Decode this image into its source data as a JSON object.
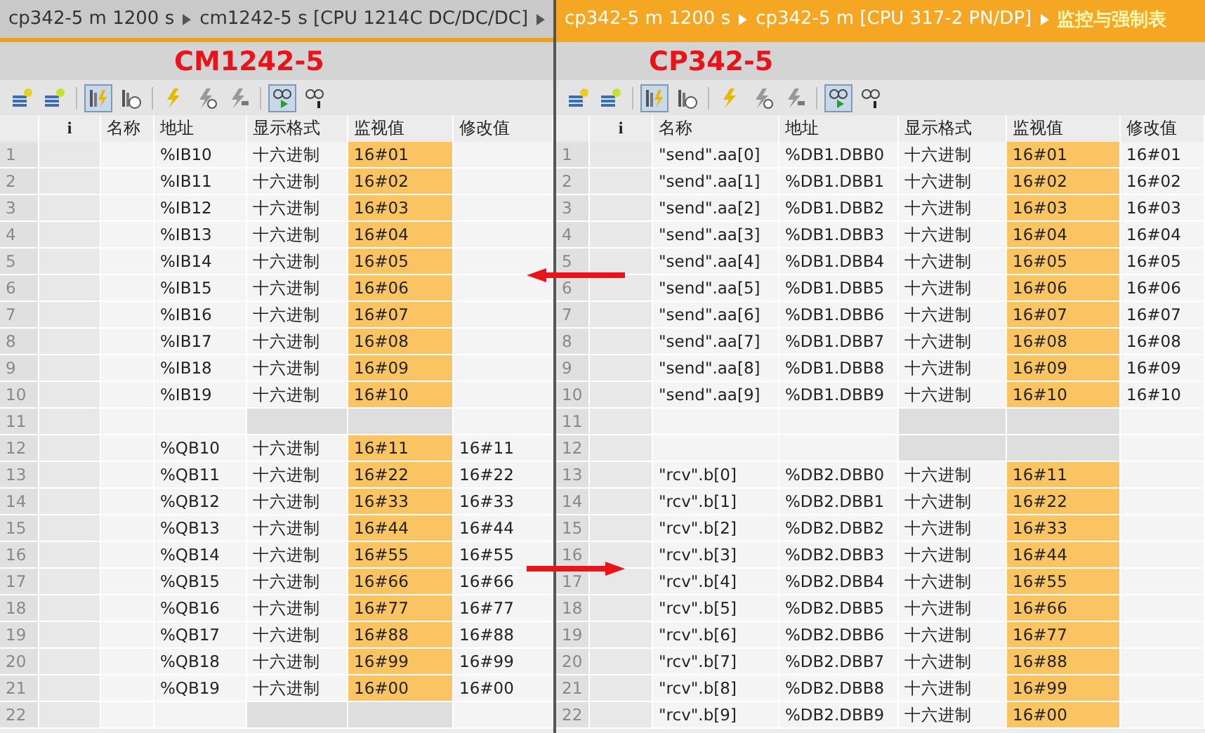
{
  "panels": [
    {
      "active": false,
      "breadcrumb": [
        "cp342-5 m 1200 s",
        "cm1242-5 s [CPU 1214C DC/DC/DC]"
      ],
      "trailing_separator": true,
      "label": "CM1242-5",
      "toolbar": [
        {
          "kind": "insert",
          "selected": false
        },
        {
          "kind": "add",
          "selected": false
        },
        {
          "kind": "monitor-flash",
          "selected": true
        },
        {
          "kind": "monitor-clock",
          "selected": false
        },
        {
          "kind": "flash",
          "selected": false
        },
        {
          "kind": "flash-clock",
          "selected": false
        },
        {
          "kind": "flash-pen",
          "selected": false
        },
        {
          "kind": "glasses-play",
          "selected": true
        },
        {
          "kind": "glasses",
          "selected": false
        }
      ],
      "columns": [
        "i",
        "名称",
        "地址",
        "显示格式",
        "监视值",
        "修改值"
      ],
      "rows": [
        {
          "no": "1",
          "address": "%IB10",
          "format": "十六进制",
          "monitor": "16#01"
        },
        {
          "no": "2",
          "address": "%IB11",
          "format": "十六进制",
          "monitor": "16#02"
        },
        {
          "no": "3",
          "address": "%IB12",
          "format": "十六进制",
          "monitor": "16#03"
        },
        {
          "no": "4",
          "address": "%IB13",
          "format": "十六进制",
          "monitor": "16#04"
        },
        {
          "no": "5",
          "address": "%IB14",
          "format": "十六进制",
          "monitor": "16#05"
        },
        {
          "no": "6",
          "address": "%IB15",
          "format": "十六进制",
          "monitor": "16#06"
        },
        {
          "no": "7",
          "address": "%IB16",
          "format": "十六进制",
          "monitor": "16#07"
        },
        {
          "no": "8",
          "address": "%IB17",
          "format": "十六进制",
          "monitor": "16#08"
        },
        {
          "no": "9",
          "address": "%IB18",
          "format": "十六进制",
          "monitor": "16#09"
        },
        {
          "no": "10",
          "address": "%IB19",
          "format": "十六进制",
          "monitor": "16#10"
        },
        {
          "no": "11"
        },
        {
          "no": "12",
          "address": "%QB10",
          "format": "十六进制",
          "monitor": "16#11",
          "modify": "16#11"
        },
        {
          "no": "13",
          "address": "%QB11",
          "format": "十六进制",
          "monitor": "16#22",
          "modify": "16#22"
        },
        {
          "no": "14",
          "address": "%QB12",
          "format": "十六进制",
          "monitor": "16#33",
          "modify": "16#33"
        },
        {
          "no": "15",
          "address": "%QB13",
          "format": "十六进制",
          "monitor": "16#44",
          "modify": "16#44"
        },
        {
          "no": "16",
          "address": "%QB14",
          "format": "十六进制",
          "monitor": "16#55",
          "modify": "16#55"
        },
        {
          "no": "17",
          "address": "%QB15",
          "format": "十六进制",
          "monitor": "16#66",
          "modify": "16#66"
        },
        {
          "no": "18",
          "address": "%QB16",
          "format": "十六进制",
          "monitor": "16#77",
          "modify": "16#77"
        },
        {
          "no": "19",
          "address": "%QB17",
          "format": "十六进制",
          "monitor": "16#88",
          "modify": "16#88"
        },
        {
          "no": "20",
          "address": "%QB18",
          "format": "十六进制",
          "monitor": "16#99",
          "modify": "16#99"
        },
        {
          "no": "21",
          "address": "%QB19",
          "format": "十六进制",
          "monitor": "16#00",
          "modify": "16#00"
        },
        {
          "no": "22"
        }
      ]
    },
    {
      "active": true,
      "breadcrumb": [
        "cp342-5 m 1200 s",
        "cp342-5 m [CPU 317-2 PN/DP]",
        "监控与强制表"
      ],
      "trailing_separator": false,
      "label": "CP342-5",
      "toolbar": [
        {
          "kind": "insert",
          "selected": false
        },
        {
          "kind": "add",
          "selected": false
        },
        {
          "kind": "monitor-flash",
          "selected": true
        },
        {
          "kind": "monitor-clock",
          "selected": false
        },
        {
          "kind": "flash",
          "selected": false
        },
        {
          "kind": "flash-clock",
          "selected": false
        },
        {
          "kind": "flash-pen",
          "selected": false
        },
        {
          "kind": "glasses-play",
          "selected": true
        },
        {
          "kind": "glasses",
          "selected": false
        }
      ],
      "columns": [
        "i",
        "名称",
        "地址",
        "显示格式",
        "监视值",
        "修改值"
      ],
      "rows": [
        {
          "no": "1",
          "name": "\"send\".aa[0]",
          "address": "%DB1.DBB0",
          "format": "十六进制",
          "monitor": "16#01",
          "modify": "16#01"
        },
        {
          "no": "2",
          "name": "\"send\".aa[1]",
          "address": "%DB1.DBB1",
          "format": "十六进制",
          "monitor": "16#02",
          "modify": "16#02"
        },
        {
          "no": "3",
          "name": "\"send\".aa[2]",
          "address": "%DB1.DBB2",
          "format": "十六进制",
          "monitor": "16#03",
          "modify": "16#03"
        },
        {
          "no": "4",
          "name": "\"send\".aa[3]",
          "address": "%DB1.DBB3",
          "format": "十六进制",
          "monitor": "16#04",
          "modify": "16#04"
        },
        {
          "no": "5",
          "name": "\"send\".aa[4]",
          "address": "%DB1.DBB4",
          "format": "十六进制",
          "monitor": "16#05",
          "modify": "16#05"
        },
        {
          "no": "6",
          "name": "\"send\".aa[5]",
          "address": "%DB1.DBB5",
          "format": "十六进制",
          "monitor": "16#06",
          "modify": "16#06"
        },
        {
          "no": "7",
          "name": "\"send\".aa[6]",
          "address": "%DB1.DBB6",
          "format": "十六进制",
          "monitor": "16#07",
          "modify": "16#07"
        },
        {
          "no": "8",
          "name": "\"send\".aa[7]",
          "address": "%DB1.DBB7",
          "format": "十六进制",
          "monitor": "16#08",
          "modify": "16#08"
        },
        {
          "no": "9",
          "name": "\"send\".aa[8]",
          "address": "%DB1.DBB8",
          "format": "十六进制",
          "monitor": "16#09",
          "modify": "16#09"
        },
        {
          "no": "10",
          "name": "\"send\".aa[9]",
          "address": "%DB1.DBB9",
          "format": "十六进制",
          "monitor": "16#10",
          "modify": "16#10"
        },
        {
          "no": "11"
        },
        {
          "no": "12"
        },
        {
          "no": "13",
          "name": "\"rcv\".b[0]",
          "address": "%DB2.DBB0",
          "format": "十六进制",
          "monitor": "16#11"
        },
        {
          "no": "14",
          "name": "\"rcv\".b[1]",
          "address": "%DB2.DBB1",
          "format": "十六进制",
          "monitor": "16#22"
        },
        {
          "no": "15",
          "name": "\"rcv\".b[2]",
          "address": "%DB2.DBB2",
          "format": "十六进制",
          "monitor": "16#33"
        },
        {
          "no": "16",
          "name": "\"rcv\".b[3]",
          "address": "%DB2.DBB3",
          "format": "十六进制",
          "monitor": "16#44"
        },
        {
          "no": "17",
          "name": "\"rcv\".b[4]",
          "address": "%DB2.DBB4",
          "format": "十六进制",
          "monitor": "16#55"
        },
        {
          "no": "18",
          "name": "\"rcv\".b[5]",
          "address": "%DB2.DBB5",
          "format": "十六进制",
          "monitor": "16#66"
        },
        {
          "no": "19",
          "name": "\"rcv\".b[6]",
          "address": "%DB2.DBB6",
          "format": "十六进制",
          "monitor": "16#77"
        },
        {
          "no": "20",
          "name": "\"rcv\".b[7]",
          "address": "%DB2.DBB7",
          "format": "十六进制",
          "monitor": "16#88"
        },
        {
          "no": "21",
          "name": "\"rcv\".b[8]",
          "address": "%DB2.DBB8",
          "format": "十六进制",
          "monitor": "16#99"
        },
        {
          "no": "22",
          "name": "\"rcv\".b[9]",
          "address": "%DB2.DBB9",
          "format": "十六进制",
          "monitor": "16#00"
        }
      ]
    }
  ],
  "arrows": [
    {
      "kind": "left"
    },
    {
      "kind": "right"
    }
  ]
}
